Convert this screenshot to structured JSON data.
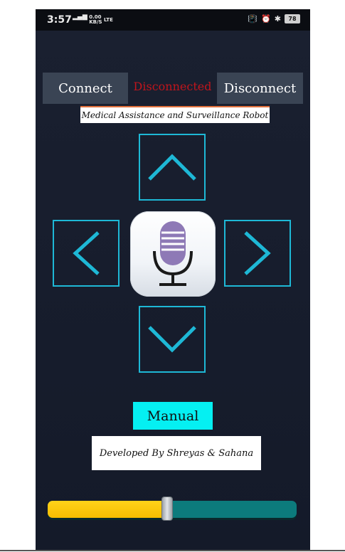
{
  "status_bar": {
    "time": "3:57",
    "network_speed": "0.00",
    "network_unit": "KB/S",
    "network_type": "LTE",
    "battery": "78"
  },
  "header": {
    "connect_label": "Connect",
    "connection_status": "Disconnected",
    "disconnect_label": "Disconnect",
    "title": "Medical Assistance and Surveillance Robot"
  },
  "controls": {
    "up_icon": "chevron-up-icon",
    "left_icon": "chevron-left-icon",
    "right_icon": "chevron-right-icon",
    "down_icon": "chevron-down-icon",
    "mic_icon": "microphone-icon",
    "accent_color": "#1eb8d6"
  },
  "mode": {
    "manual_label": "Manual",
    "button_color": "#05f0f2"
  },
  "footer": {
    "credit": "Developed By Shreyas & Sahana"
  },
  "slider": {
    "fraction": 0.48,
    "fill_color": "#f6bd00",
    "track_color": "#0c7b7c"
  }
}
